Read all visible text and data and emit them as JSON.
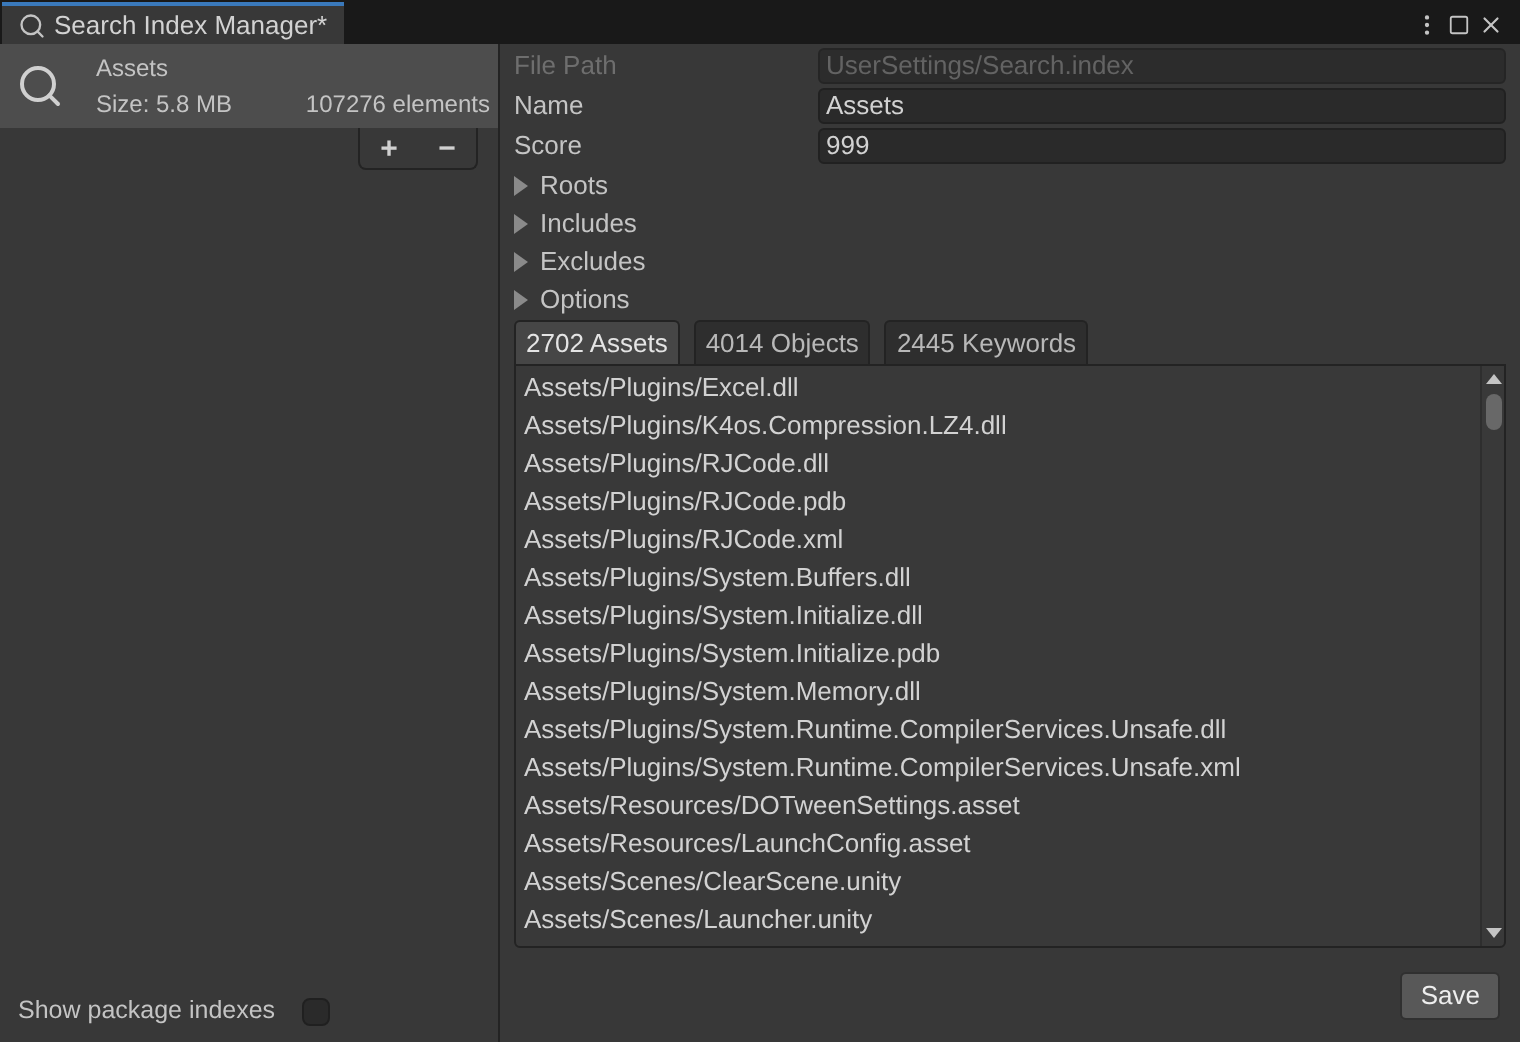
{
  "window": {
    "title": "Search Index Manager*"
  },
  "indexes": [
    {
      "name": "Assets",
      "size": "Size: 5.8 MB",
      "elements": "107276 elements",
      "selected": true
    }
  ],
  "index_buttons": [
    "+",
    "−"
  ],
  "show_package_indexes": {
    "label": "Show package indexes",
    "checked": false
  },
  "fields": [
    {
      "label": "File Path",
      "value": "UserSettings/Search.index",
      "disabled": true
    },
    {
      "label": "Name",
      "value": "Assets",
      "disabled": false
    },
    {
      "label": "Score",
      "value": "999",
      "disabled": false
    }
  ],
  "foldouts": [
    {
      "label": "Roots",
      "expanded": false
    },
    {
      "label": "Includes",
      "expanded": false
    },
    {
      "label": "Excludes",
      "expanded": false
    },
    {
      "label": "Options",
      "expanded": false
    }
  ],
  "tabs": [
    {
      "label": "2702 Assets",
      "selected": true
    },
    {
      "label": "4014 Objects",
      "selected": false
    },
    {
      "label": "2445 Keywords",
      "selected": false
    }
  ],
  "items": [
    "Assets/Plugins/Excel.dll",
    "Assets/Plugins/K4os.Compression.LZ4.dll",
    "Assets/Plugins/RJCode.dll",
    "Assets/Plugins/RJCode.pdb",
    "Assets/Plugins/RJCode.xml",
    "Assets/Plugins/System.Buffers.dll",
    "Assets/Plugins/System.Initialize.dll",
    "Assets/Plugins/System.Initialize.pdb",
    "Assets/Plugins/System.Memory.dll",
    "Assets/Plugins/System.Runtime.CompilerServices.Unsafe.dll",
    "Assets/Plugins/System.Runtime.CompilerServices.Unsafe.xml",
    "Assets/Resources/DOTweenSettings.asset",
    "Assets/Resources/LaunchConfig.asset",
    "Assets/Scenes/ClearScene.unity",
    "Assets/Scenes/Launcher.unity"
  ],
  "save_button": "Save"
}
